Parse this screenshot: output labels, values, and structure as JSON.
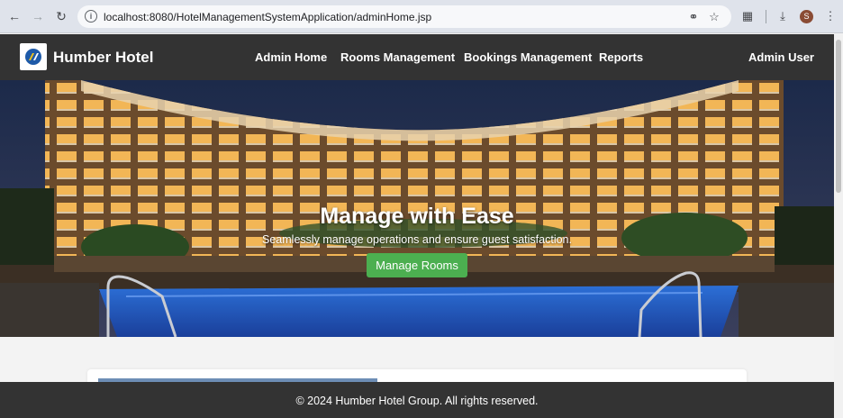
{
  "browser": {
    "url": "localhost:8080/HotelManagementSystemApplication/adminHome.jsp",
    "profile_initial": "S",
    "icons": [
      "back-icon",
      "forward-icon",
      "reload-icon",
      "site-info-icon",
      "password-key-icon",
      "bookmark-star-icon",
      "extensions-icon",
      "download-icon",
      "menu-dots-icon"
    ]
  },
  "navbar": {
    "brand": "Humber Hotel",
    "links": [
      "Admin Home",
      "Rooms Management",
      "Bookings Management",
      "Reports"
    ],
    "user": "Admin User",
    "background": "#333333"
  },
  "hero": {
    "title": "Manage with Ease",
    "subtitle": "Seamlessly manage operations and ensure guest satisfaction.",
    "button_label": "Manage Rooms",
    "button_color": "#4caf50"
  },
  "footer": {
    "text": "© 2024 Humber Hotel Group. All rights reserved."
  }
}
